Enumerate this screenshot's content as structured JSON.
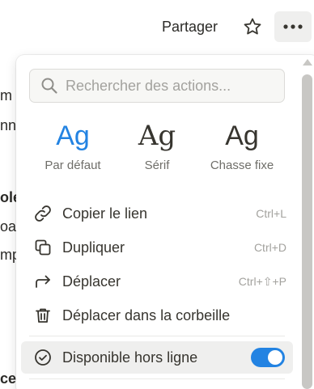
{
  "background_doc": {
    "lines": [
      {
        "text": "m",
        "bold": false
      },
      {
        "text": "nn",
        "bold": false
      },
      {
        "text": "ole",
        "bold": true
      },
      {
        "text": "oac",
        "bold": false
      },
      {
        "text": "mp",
        "bold": false
      },
      {
        "text": "ce",
        "bold": true
      }
    ]
  },
  "topbar": {
    "share_label": "Partager",
    "star_icon": "star-icon",
    "more_icon": "more-horizontal-icon"
  },
  "menu": {
    "search": {
      "placeholder": "Rechercher des actions...",
      "value": ""
    },
    "fonts": [
      {
        "sample": "Ag",
        "label": "Par défaut",
        "selected": true,
        "color": "#2383e2"
      },
      {
        "sample": "Ag",
        "label": "Sérif",
        "selected": false
      },
      {
        "sample": "Ag",
        "label": "Chasse fixe",
        "selected": false
      }
    ],
    "items": [
      {
        "label": "Copier le lien",
        "shortcut": "Ctrl+L",
        "icon": "link-icon"
      },
      {
        "label": "Dupliquer",
        "shortcut": "Ctrl+D",
        "icon": "duplicate-icon"
      },
      {
        "label": "Déplacer",
        "shortcut": "Ctrl+⇧+P",
        "icon": "move-arrow-icon"
      },
      {
        "label": "Déplacer dans la corbeille",
        "shortcut": "",
        "icon": "trash-icon"
      }
    ],
    "offline": {
      "label": "Disponible hors ligne",
      "icon": "check-circle-icon",
      "enabled": true,
      "toggle_color": "#2383e2"
    }
  }
}
